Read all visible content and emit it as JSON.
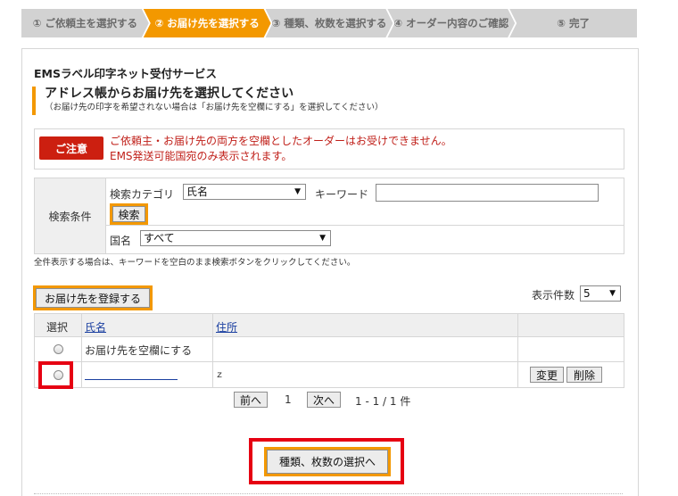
{
  "steps": [
    {
      "label": "① ご依頼主を選択する",
      "active": false
    },
    {
      "label": "② お届け先を選択する",
      "active": true
    },
    {
      "label": "③ 種類、枚数を選択する",
      "active": false
    },
    {
      "label": "④ オーダー内容のご確認",
      "active": false
    },
    {
      "label": "⑤ 完了",
      "active": false
    }
  ],
  "service_title": "EMSラベル印字ネット受付サービス",
  "section": {
    "heading": "アドレス帳からお届け先を選択してください",
    "subtext": "（お届け先の印字を希望されない場合は「お届け先を空欄にする」を選択してください）"
  },
  "notice": {
    "badge": "ご注意",
    "line1": "ご依頼主・お届け先の両方を空欄としたオーダーはお受けできません。",
    "line2": "EMS発送可能国宛のみ表示されます。"
  },
  "search": {
    "label": "検索条件",
    "category_label": "検索カテゴリ",
    "category_value": "氏名",
    "keyword_label": "キーワード",
    "keyword_value": "",
    "search_button": "検索",
    "country_label": "国名",
    "country_value": "すべて",
    "hint": "全件表示する場合は、キーワードを空白のまま検索ボタンをクリックしてください。"
  },
  "register_button": "お届け先を登録する",
  "per_page": {
    "label": "表示件数",
    "value": "5"
  },
  "table": {
    "headers": {
      "select": "選択",
      "name": "氏名",
      "address": "住所"
    },
    "rows": [
      {
        "name": "お届け先を空欄にする",
        "address": ""
      },
      {
        "name": "",
        "address": "ｚ"
      }
    ],
    "edit_button": "変更",
    "delete_button": "削除"
  },
  "pager": {
    "prev": "前へ",
    "page": "1",
    "next": "次へ",
    "range": "1 - 1 / 1 件"
  },
  "next_step_button": "種類、枚数の選択へ",
  "colors": {
    "accent": "#f39800",
    "alert": "#cc1f10",
    "highlight": "#e60012",
    "link": "#1a3fa0"
  }
}
